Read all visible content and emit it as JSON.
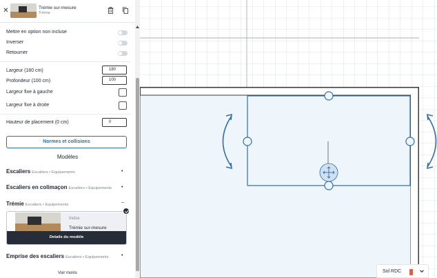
{
  "header": {
    "title": "Trémie sur-mesure",
    "subtitle": "Trémie",
    "close_icon": "close-icon",
    "delete_icon": "trash-icon",
    "duplicate_icon": "copy-icon"
  },
  "options": {
    "mettre_en_option": "Mettre en option non incluse",
    "inverser": "Inverser",
    "retourner": "Retourner"
  },
  "dimensions": {
    "largeur_label": "Largeur (180 cm)",
    "largeur_value": "180",
    "profondeur_label": "Profondeur (100 cm)",
    "profondeur_value": "100",
    "largeur_fixe_gauche": "Largeur fixe à gauche",
    "largeur_fixe_droite": "Largeur fixe à droite",
    "hauteur_label": "Hauteur de placement (0 cm)",
    "hauteur_value": "0"
  },
  "normes_button": "Normes et collisions",
  "modeles": {
    "title": "Modèles",
    "categories": [
      {
        "name": "Escaliers",
        "tag": "Escaliers • Equipements",
        "state": "collapsed"
      },
      {
        "name": "Escaliers en colimaçon",
        "tag": "Escaliers • Equipements",
        "state": "collapsed"
      },
      {
        "name": "Trémie",
        "tag": "Escaliers • Equipements",
        "state": "expanded"
      },
      {
        "name": "Emprise des escaliers",
        "tag": "Escaliers • Equipements",
        "state": "collapsed"
      }
    ],
    "card": {
      "status": "Inclus",
      "name": "Trémie sur-mesure",
      "details_label": "Details du modèle"
    },
    "voir_moins": "Voir moins"
  },
  "canvas": {
    "floor_selector": {
      "label": "Sol RDC",
      "swatch_color": "#d3664a"
    },
    "colors": {
      "grid": "#c8ccd2",
      "room_fill": "#eef5fb",
      "wall": "#3a3a3a",
      "selection": "#2f6ea8"
    }
  }
}
